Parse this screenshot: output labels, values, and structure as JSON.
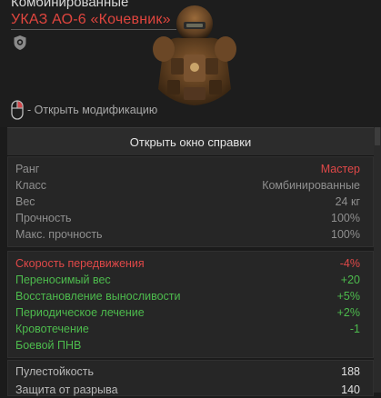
{
  "item": {
    "category": "Комбинированные",
    "name": "УКАЗ АО-6 «Кочевник»",
    "mod_hint": "- Открыть модификацию"
  },
  "help_button": "Открыть окно справки",
  "basic_stats": [
    {
      "label": "Ранг",
      "value": "Мастер"
    },
    {
      "label": "Класс",
      "value": "Комбинированные"
    },
    {
      "label": "Вес",
      "value": "24 кг"
    },
    {
      "label": "Прочность",
      "value": "100%"
    },
    {
      "label": "Макс. прочность",
      "value": "100%"
    }
  ],
  "effects": [
    {
      "label": "Скорость передвижения",
      "value": "-4%"
    },
    {
      "label": "Переносимый вес",
      "value": "+20"
    },
    {
      "label": "Восстановление выносливости",
      "value": "+5%"
    },
    {
      "label": "Периодическое лечение",
      "value": "+2%"
    },
    {
      "label": "Кровотечение",
      "value": "-1"
    },
    {
      "label": "Боевой ПНВ",
      "value": ""
    }
  ],
  "protection": [
    {
      "label": "Пулестойкость",
      "value": "188"
    },
    {
      "label": "Защита от разрыва",
      "value": "140"
    }
  ],
  "colors": {
    "rank_master": "#e0453e",
    "negative": "#e04848",
    "positive": "#4dbb4d"
  },
  "icons": [
    "shield-icon",
    "armor-item-image",
    "mouse-right-click-icon"
  ]
}
